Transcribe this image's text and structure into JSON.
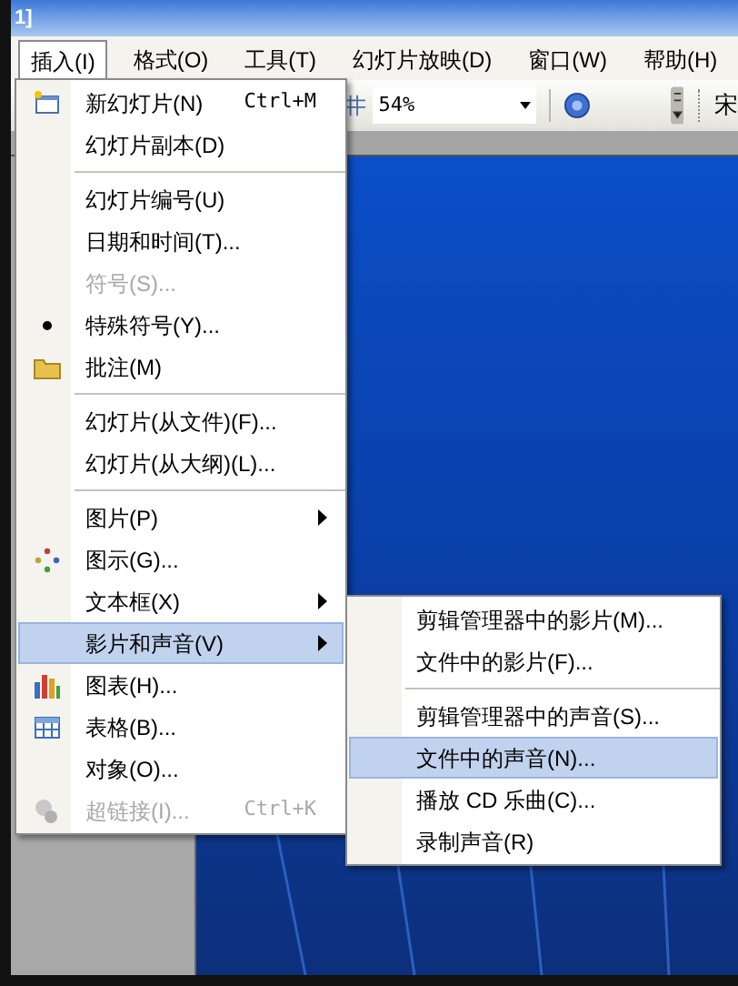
{
  "window": {
    "title": "1]"
  },
  "menubar": [
    {
      "label": "插入(I)",
      "selected": true
    },
    {
      "label": "格式(O)",
      "selected": false
    },
    {
      "label": "工具(T)",
      "selected": false
    },
    {
      "label": "幻灯片放映(D)",
      "selected": false
    },
    {
      "label": "窗口(W)",
      "selected": false
    },
    {
      "label": "帮助(H)",
      "selected": false
    }
  ],
  "toolbar": {
    "zoom": "54%",
    "font": "宋"
  },
  "menu": {
    "items": [
      {
        "label": "新幻灯片(N)",
        "shortcut": "Ctrl+M",
        "disabled": false,
        "selected": false,
        "submenu": false,
        "separator_before": false
      },
      {
        "label": "幻灯片副本(D)",
        "disabled": false,
        "selected": false,
        "submenu": false,
        "separator_before": false
      },
      {
        "label": "幻灯片编号(U)",
        "disabled": false,
        "selected": false,
        "submenu": false,
        "separator_before": true
      },
      {
        "label": "日期和时间(T)...",
        "disabled": false,
        "selected": false,
        "submenu": false,
        "separator_before": false
      },
      {
        "label": "符号(S)...",
        "disabled": true,
        "selected": false,
        "submenu": false,
        "separator_before": false
      },
      {
        "label": "特殊符号(Y)...",
        "disabled": false,
        "selected": false,
        "submenu": false,
        "separator_before": false
      },
      {
        "label": "批注(M)",
        "disabled": false,
        "selected": false,
        "submenu": false,
        "separator_before": false
      },
      {
        "label": "幻灯片(从文件)(F)...",
        "disabled": false,
        "selected": false,
        "submenu": false,
        "separator_before": true
      },
      {
        "label": "幻灯片(从大纲)(L)...",
        "disabled": false,
        "selected": false,
        "submenu": false,
        "separator_before": false
      },
      {
        "label": "图片(P)",
        "disabled": false,
        "selected": false,
        "submenu": true,
        "separator_before": true
      },
      {
        "label": "图示(G)...",
        "disabled": false,
        "selected": false,
        "submenu": false,
        "separator_before": false
      },
      {
        "label": "文本框(X)",
        "disabled": false,
        "selected": false,
        "submenu": true,
        "separator_before": false
      },
      {
        "label": "影片和声音(V)",
        "disabled": false,
        "selected": true,
        "submenu": true,
        "separator_before": false
      },
      {
        "label": "图表(H)...",
        "disabled": false,
        "selected": false,
        "submenu": false,
        "separator_before": false
      },
      {
        "label": "表格(B)...",
        "disabled": false,
        "selected": false,
        "submenu": false,
        "separator_before": false
      },
      {
        "label": "对象(O)...",
        "disabled": false,
        "selected": false,
        "submenu": false,
        "separator_before": false
      },
      {
        "label": "超链接(I)...",
        "shortcut": "Ctrl+K",
        "disabled": true,
        "selected": false,
        "submenu": false,
        "separator_before": false
      }
    ]
  },
  "submenu": {
    "items": [
      {
        "label": "剪辑管理器中的影片(M)...",
        "selected": false,
        "separator_before": false
      },
      {
        "label": "文件中的影片(F)...",
        "selected": false,
        "separator_before": false
      },
      {
        "label": "剪辑管理器中的声音(S)...",
        "selected": false,
        "separator_before": true
      },
      {
        "label": "文件中的声音(N)...",
        "selected": true,
        "separator_before": false
      },
      {
        "label": "播放 CD 乐曲(C)...",
        "selected": false,
        "separator_before": false
      },
      {
        "label": "录制声音(R)",
        "selected": false,
        "separator_before": false
      }
    ]
  }
}
